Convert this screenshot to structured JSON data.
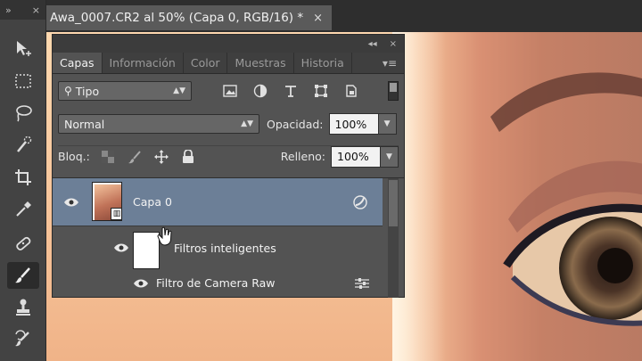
{
  "toolbar": {
    "collapse_label": "»",
    "close_label": "×",
    "tools": [
      "move-tool",
      "marquee-tool",
      "lasso-tool",
      "quick-selection-tool",
      "crop-tool",
      "eyedropper-tool",
      "healing-brush-tool",
      "brush-tool",
      "clone-stamp-tool",
      "history-brush-tool"
    ],
    "active_tool": "brush-tool"
  },
  "document": {
    "tab_title": "Awa_0007.CR2 al 50% (Capa 0, RGB/16) *",
    "close_label": "×"
  },
  "panel": {
    "header_collapse": "◂◂",
    "header_close": "×",
    "tabs": [
      {
        "label": "Capas",
        "active": true
      },
      {
        "label": "Información",
        "active": false
      },
      {
        "label": "Color",
        "active": false
      },
      {
        "label": "Muestras",
        "active": false
      },
      {
        "label": "Historia",
        "active": false
      }
    ],
    "menu_icon": "▾≡",
    "filter": {
      "label": "Tipo",
      "icon": "search-icon"
    },
    "filter_icons": [
      "image-filter-icon",
      "adjustment-filter-icon",
      "type-filter-icon",
      "shape-filter-icon",
      "smart-object-filter-icon"
    ],
    "blend_mode": "Normal",
    "opacity_label": "Opacidad:",
    "opacity_value": "100%",
    "lock_label": "Bloq.:",
    "fill_label": "Relleno:",
    "fill_value": "100%",
    "layers": [
      {
        "name": "Capa 0",
        "selected": true
      },
      {
        "name": "Filtros inteligentes",
        "selected": false
      },
      {
        "name": "Filtro de Camera Raw",
        "selected": false
      }
    ]
  },
  "colors": {
    "selection": "#6c7f97",
    "panel_bg": "#535353",
    "tabbar_bg": "#3f3f3f"
  }
}
